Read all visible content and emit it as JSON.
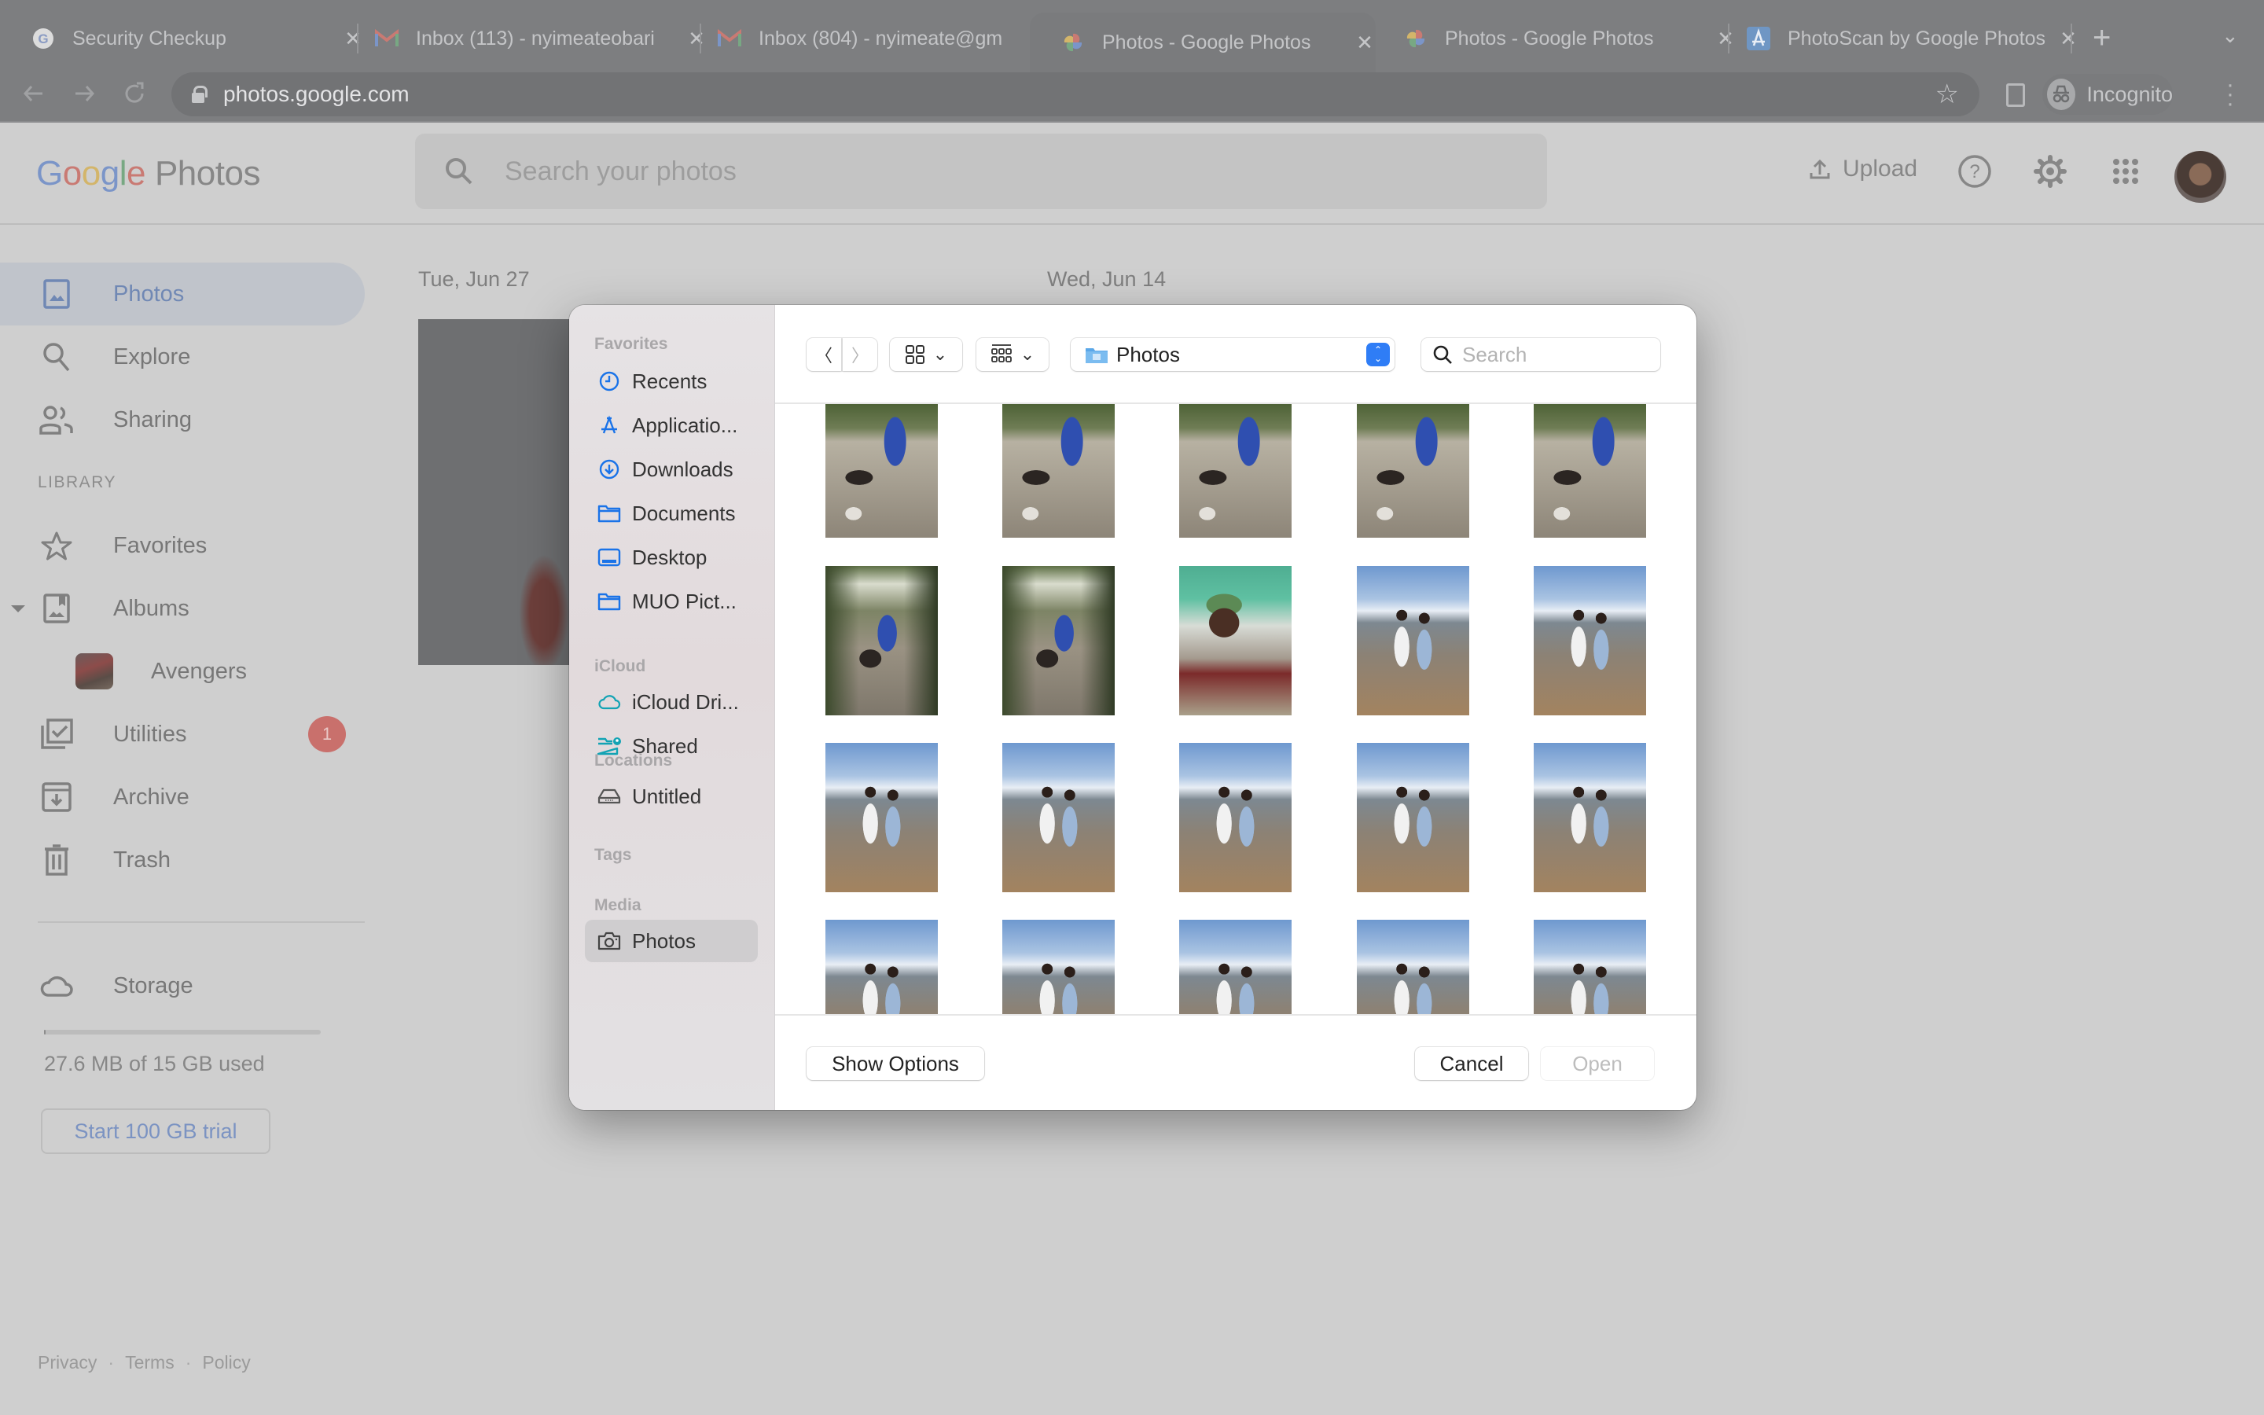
{
  "browser": {
    "tabs": [
      {
        "title": "Security Checkup",
        "icon": "google-g-icon",
        "active": false
      },
      {
        "title": "Inbox (113) - nyimeateobari",
        "icon": "gmail-icon",
        "active": false
      },
      {
        "title": "Inbox (804) - nyimeate@gm",
        "icon": "gmail-icon",
        "active": false
      },
      {
        "title": "Photos - Google Photos",
        "icon": "google-photos-icon",
        "active": true
      },
      {
        "title": "Photos - Google Photos",
        "icon": "google-photos-icon",
        "active": false
      },
      {
        "title": "PhotoScan by Google Photos",
        "icon": "app-store-icon",
        "active": false
      }
    ],
    "close_glyph": "✕",
    "new_tab_glyph": "+",
    "tab_list_glyph": "⌄",
    "url": "photos.google.com",
    "incognito_label": "Incognito"
  },
  "header": {
    "logo_google": [
      "G",
      "o",
      "o",
      "g",
      "l",
      "e"
    ],
    "logo_product": "Photos",
    "search_placeholder": "Search your photos",
    "upload_label": "Upload"
  },
  "sidebar": {
    "nav": [
      {
        "label": "Photos",
        "icon": "photo-icon",
        "active": true
      },
      {
        "label": "Explore",
        "icon": "search-icon",
        "active": false
      },
      {
        "label": "Sharing",
        "icon": "people-icon",
        "active": false
      }
    ],
    "library_heading": "LIBRARY",
    "library": [
      {
        "label": "Favorites",
        "icon": "star-icon"
      },
      {
        "label": "Albums",
        "icon": "album-icon",
        "expanded": true
      },
      {
        "label": "Avengers",
        "icon": "album-thumbnail"
      },
      {
        "label": "Utilities",
        "icon": "utilities-icon",
        "badge": "1"
      },
      {
        "label": "Archive",
        "icon": "archive-icon"
      },
      {
        "label": "Trash",
        "icon": "trash-icon"
      }
    ],
    "storage": {
      "label": "Storage",
      "used_text": "27.6 MB of 15 GB used",
      "used_fraction": 0.0018,
      "trial_button": "Start 100 GB trial"
    },
    "footer": [
      "Privacy",
      "Terms",
      "Policy"
    ],
    "footer_sep": "·"
  },
  "main": {
    "dates": [
      "Tue, Jun 27",
      "Wed, Jun 14"
    ]
  },
  "dialog": {
    "sidebar": {
      "sections": [
        {
          "heading": "Favorites",
          "items": [
            {
              "label": "Recents",
              "icon": "clock-icon"
            },
            {
              "label": "Applicatio...",
              "icon": "applications-icon"
            },
            {
              "label": "Downloads",
              "icon": "download-icon"
            },
            {
              "label": "Documents",
              "icon": "folder-icon"
            },
            {
              "label": "Desktop",
              "icon": "desktop-icon"
            },
            {
              "label": "MUO Pict...",
              "icon": "folder-icon"
            }
          ]
        },
        {
          "heading": "iCloud",
          "items": [
            {
              "label": "iCloud Dri...",
              "icon": "icloud-icon"
            },
            {
              "label": "Shared",
              "icon": "shared-folder-icon"
            }
          ]
        },
        {
          "heading": "Locations",
          "items": [
            {
              "label": "Untitled",
              "icon": "drive-icon"
            }
          ]
        },
        {
          "heading": "Tags",
          "items": []
        },
        {
          "heading": "Media",
          "items": [
            {
              "label": "Photos",
              "icon": "camera-icon",
              "selected": true
            }
          ]
        }
      ]
    },
    "toolbar": {
      "back_glyph": "〈",
      "forward_glyph": "〉",
      "view_chevron": "⌄",
      "location": "Photos",
      "search_placeholder": "Search"
    },
    "thumbnails": [
      {
        "scene": "trail-dogs"
      },
      {
        "scene": "trail-dogs"
      },
      {
        "scene": "trail-dogs"
      },
      {
        "scene": "trail-dogs"
      },
      {
        "scene": "trail-dogs"
      },
      {
        "scene": "trail-dogs-dark"
      },
      {
        "scene": "trail-dogs-dark"
      },
      {
        "scene": "selfie-green-tent"
      },
      {
        "scene": "beach-two-people"
      },
      {
        "scene": "beach-two-people"
      },
      {
        "scene": "beach-two-people"
      },
      {
        "scene": "beach-two-people"
      },
      {
        "scene": "beach-two-people"
      },
      {
        "scene": "beach-two-people"
      },
      {
        "scene": "beach-two-people"
      },
      {
        "scene": "beach-two-people"
      },
      {
        "scene": "beach-two-people"
      },
      {
        "scene": "beach-two-people"
      },
      {
        "scene": "beach-two-people"
      },
      {
        "scene": "beach-two-people"
      }
    ],
    "buttons": {
      "show_options": "Show Options",
      "cancel": "Cancel",
      "open": "Open"
    }
  }
}
